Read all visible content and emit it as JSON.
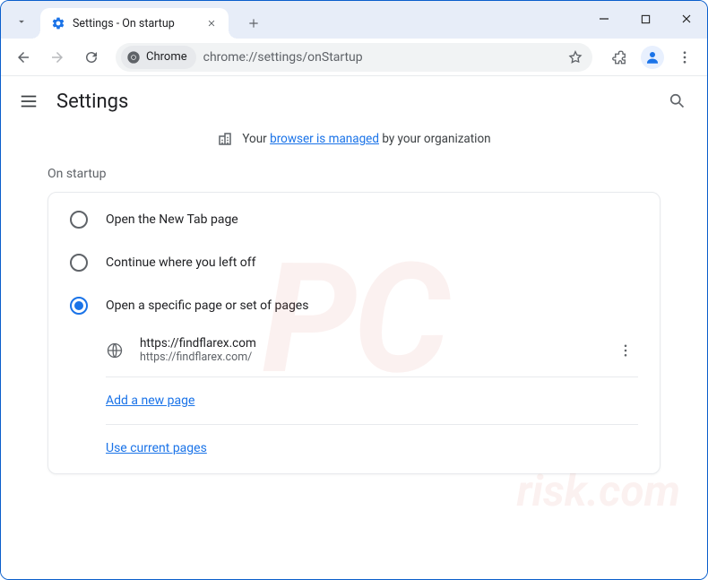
{
  "window": {
    "tab_title": "Settings - On startup"
  },
  "toolbar": {
    "site_chip_label": "Chrome",
    "url": "chrome://settings/onStartup"
  },
  "settings": {
    "title": "Settings",
    "managed_prefix": "Your ",
    "managed_link": "browser is managed",
    "managed_suffix": " by your organization",
    "section_label": "On startup",
    "options": {
      "newtab": "Open the New Tab page",
      "continue": "Continue where you left off",
      "specific": "Open a specific page or set of pages"
    },
    "startup_page": {
      "title": "https://findflarex.com",
      "url": "https://findflarex.com/"
    },
    "add_page_link": "Add a new page",
    "use_current_link": "Use current pages"
  },
  "watermark": {
    "main": "PC",
    "sub": "risk.com"
  }
}
